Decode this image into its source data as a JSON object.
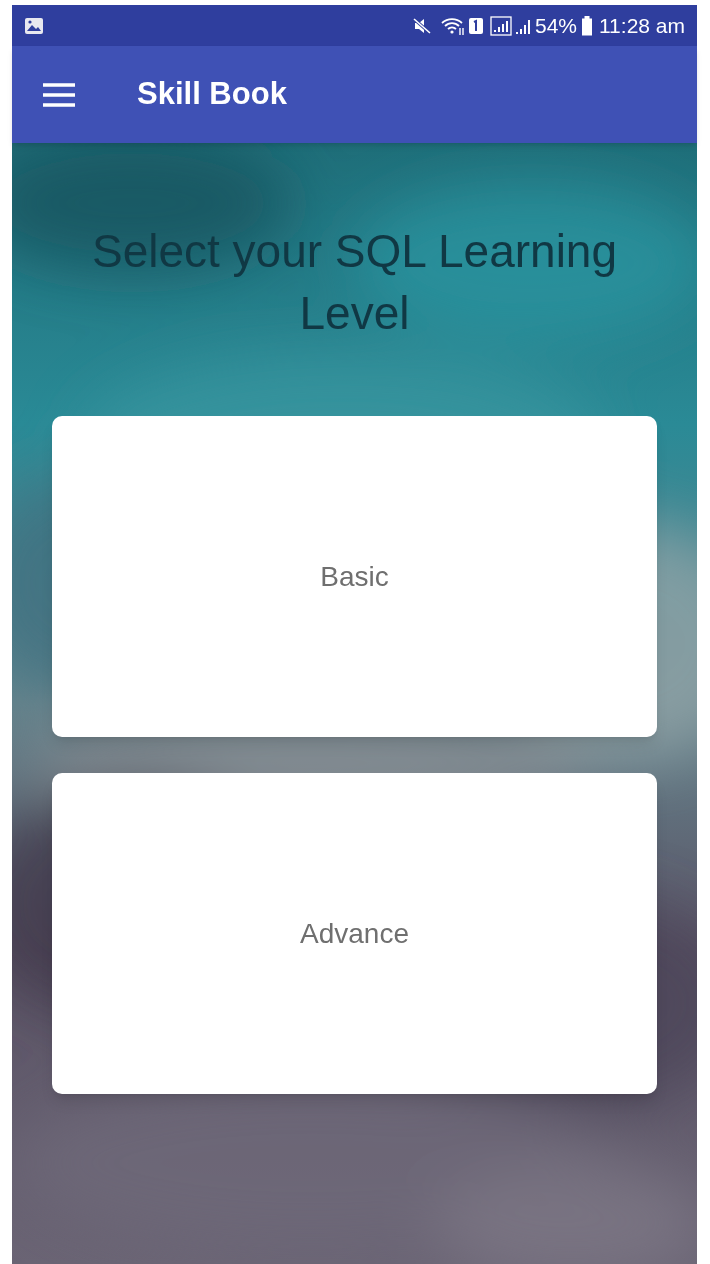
{
  "status_bar": {
    "battery": "54%",
    "time": "11:28 am"
  },
  "app_bar": {
    "title": "Skill Book"
  },
  "heading": "Select your SQL Learning Level",
  "levels": [
    {
      "label": "Basic"
    },
    {
      "label": "Advance"
    }
  ]
}
